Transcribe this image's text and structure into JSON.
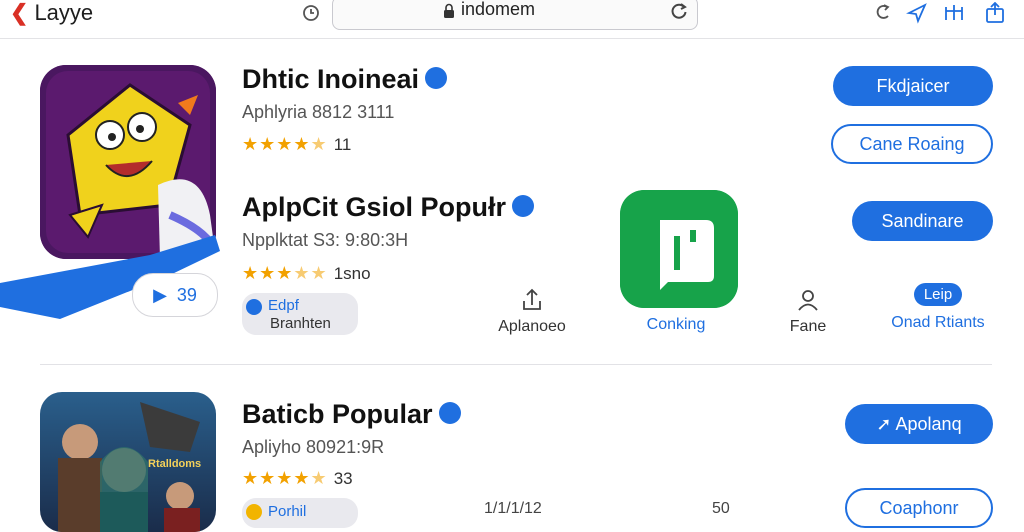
{
  "topbar": {
    "back_label": "Layye",
    "url": "indomem"
  },
  "apps": [
    {
      "title": "Dhtic Inoineai",
      "subtitle": "Aphlyria 8812 3111",
      "rating_count": "11",
      "primary_button": "Fkdjaicer",
      "secondary_button": "Cane Roaing"
    },
    {
      "title": "AplpCit Gsiol Popułr",
      "subtitle": "Npplktat S3: 9:80:3H",
      "rating_count": "1sno",
      "primary_button": "Sandinare",
      "play_count": "39",
      "chip_line1": "Edpf",
      "chip_line2": "Branhten",
      "actions": [
        "Aplanoeo",
        "Conking",
        "Fane",
        "Onad Rtiants"
      ],
      "help_chip": "Leip"
    },
    {
      "title": "Baticb Popular",
      "subtitle": "Apliyho 80921:9R",
      "rating_count": "33",
      "primary_button": "Apolanq",
      "secondary_button": "Coaphonr",
      "chip_label": "Porhil",
      "poster_text": "Rtalldoms",
      "partial_1": "1/1/1/12",
      "partial_2": "50"
    }
  ],
  "colors": {
    "accent": "#1f6fe0",
    "star": "#f2a100",
    "green_icon": "#17a34a",
    "purple_icon": "#5b1a6e"
  }
}
